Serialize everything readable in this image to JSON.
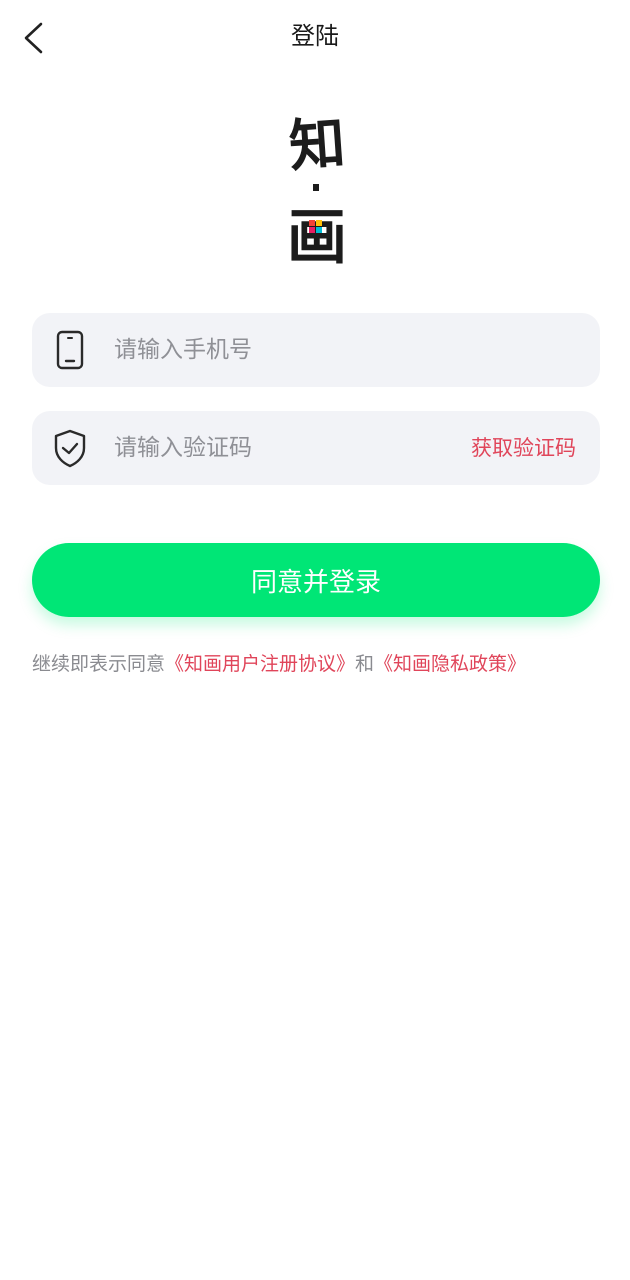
{
  "header": {
    "title": "登陆",
    "back_icon": "chevron-left-icon"
  },
  "logo": {
    "char_top": "知",
    "char_bottom": "画",
    "colors": [
      "#f44336",
      "#ffc107",
      "#00bcd4",
      "#e91e63"
    ]
  },
  "phone_field": {
    "icon": "phone-icon",
    "value": "",
    "placeholder": "请输入手机号"
  },
  "code_field": {
    "icon": "shield-check-icon",
    "value": "",
    "placeholder": "请输入验证码",
    "get_code_label": "获取验证码"
  },
  "login_button": {
    "label": "同意并登录"
  },
  "agreement": {
    "prefix": "继续即表示同意",
    "user_agreement": "《知画用户注册协议》",
    "conjunction": "和",
    "privacy_policy": "《知画隐私政策》"
  },
  "colors": {
    "accent_green": "#00e676",
    "link_red": "#e0455a",
    "field_bg": "#f2f3f7",
    "placeholder_gray": "#8f9096"
  }
}
